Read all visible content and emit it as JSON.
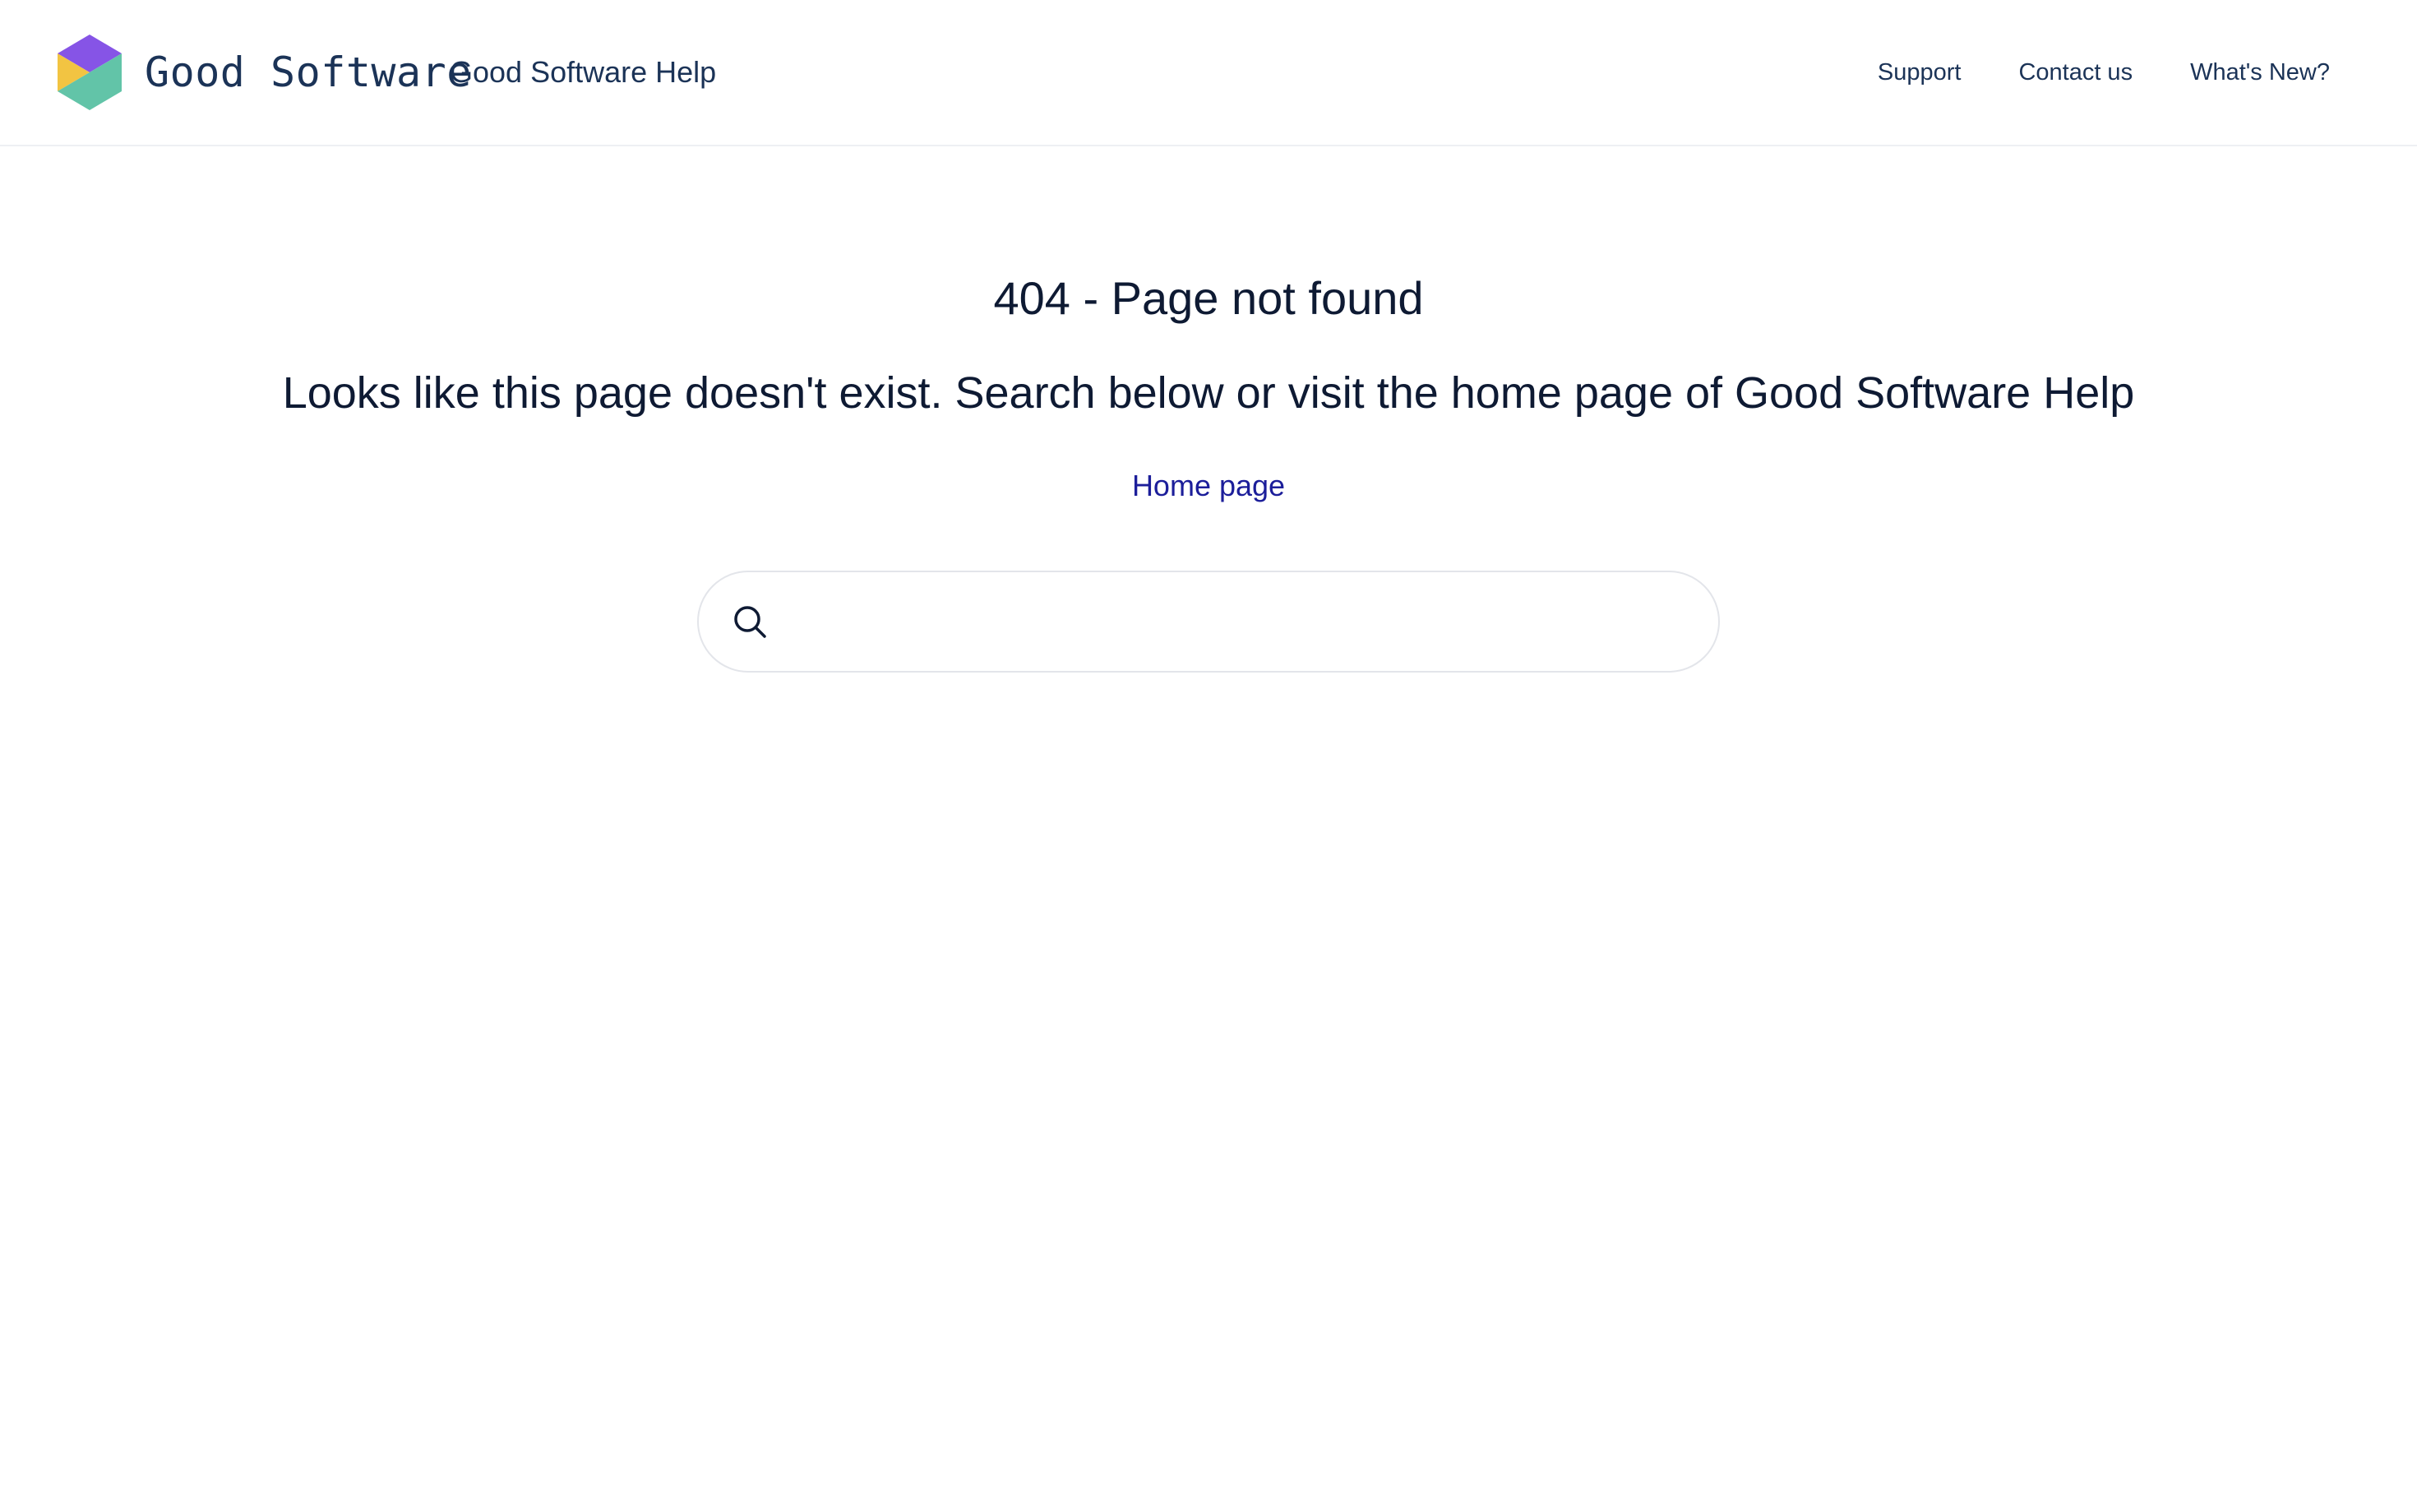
{
  "header": {
    "brand_name": "Good Software",
    "site_title": "Good Software Help",
    "logo_icon": "hexagon-logo-icon",
    "nav": [
      {
        "label": "Support"
      },
      {
        "label": "Contact us"
      },
      {
        "label": "What's New?"
      }
    ]
  },
  "main": {
    "title": "404 - Page not found",
    "message": "Looks like this page doesn't exist. Search below or visit the home page of Good Software Help",
    "home_link": "Home page",
    "search": {
      "value": "",
      "placeholder": "",
      "icon": "search-icon"
    }
  },
  "colors": {
    "text_dark": "#0e1a33",
    "header_text": "#1b3357",
    "link": "#1c1e9a",
    "logo_purple": "#8654e6",
    "logo_teal": "#62c4a8",
    "logo_yellow": "#f2c442"
  }
}
